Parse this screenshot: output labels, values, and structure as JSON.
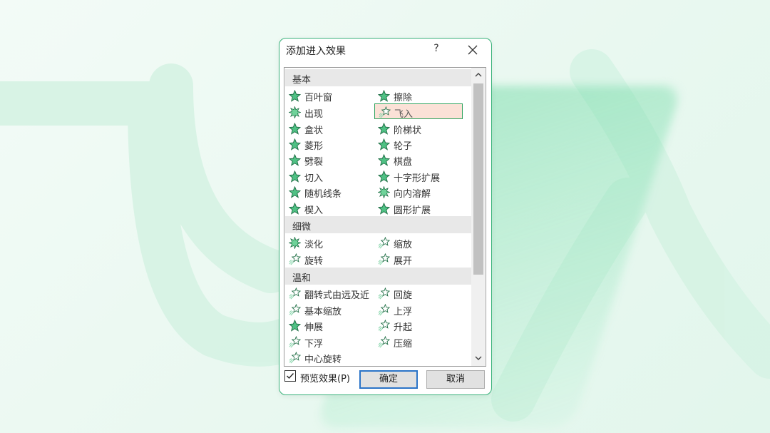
{
  "dialog": {
    "title": "添加进入效果",
    "help": "?",
    "sections": [
      {
        "name": "基本",
        "items": [
          "百叶窗",
          "擦除",
          "出现",
          "飞入",
          "盒状",
          "阶梯状",
          "菱形",
          "轮子",
          "劈裂",
          "棋盘",
          "切入",
          "十字形扩展",
          "随机线条",
          "向内溶解",
          "楔入",
          "圆形扩展"
        ]
      },
      {
        "name": "细微",
        "items": [
          "淡化",
          "缩放",
          "旋转",
          "展开"
        ]
      },
      {
        "name": "温和",
        "items": [
          "翻转式由远及近",
          "回旋",
          "基本缩放",
          "上浮",
          "伸展",
          "升起",
          "下浮",
          "压缩",
          "中心旋转"
        ]
      }
    ],
    "selected_item": "飞入",
    "preview_label": "预览效果(P)",
    "preview_checked": true,
    "ok_label": "确定",
    "cancel_label": "取消"
  },
  "background_watermark": "飞入",
  "colors": {
    "accent_green": "#2fa35f",
    "selected_fill": "#fbe1d7",
    "default_button_border": "#2b74c8"
  }
}
